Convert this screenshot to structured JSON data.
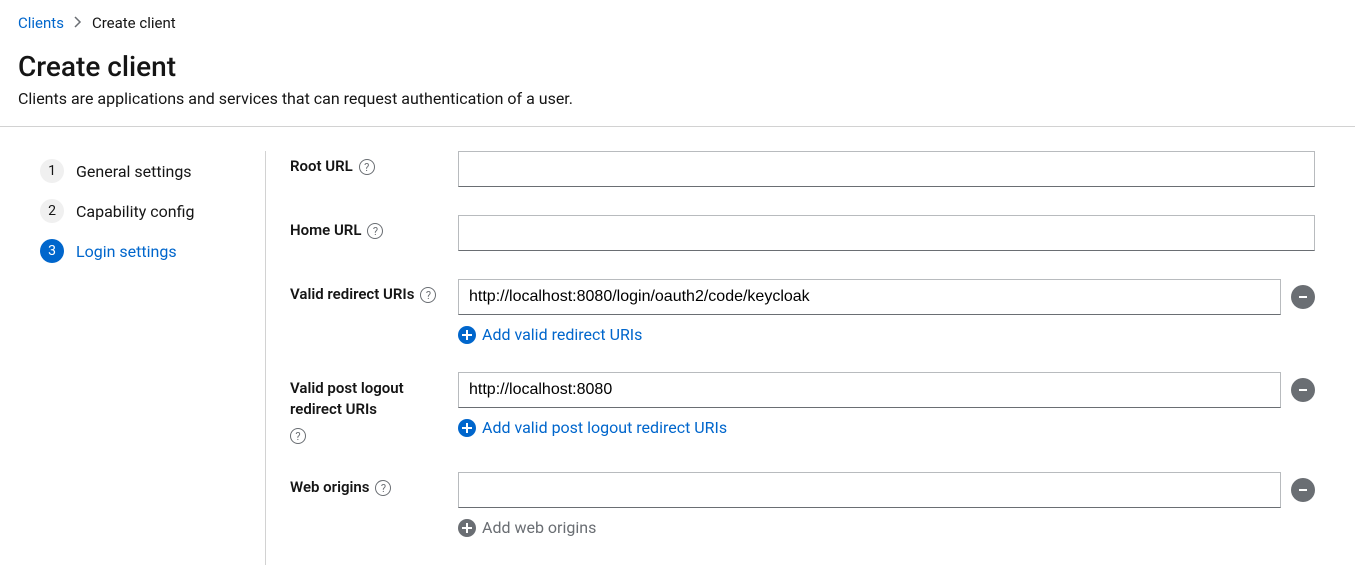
{
  "breadcrumb": {
    "parent": "Clients",
    "current": "Create client"
  },
  "page": {
    "title": "Create client",
    "description": "Clients are applications and services that can request authentication of a user."
  },
  "wizard": {
    "steps": [
      {
        "num": "1",
        "label": "General settings"
      },
      {
        "num": "2",
        "label": "Capability config"
      },
      {
        "num": "3",
        "label": "Login settings"
      }
    ]
  },
  "form": {
    "root_url": {
      "label": "Root URL",
      "value": ""
    },
    "home_url": {
      "label": "Home URL",
      "value": ""
    },
    "redirect_uris": {
      "label": "Valid redirect URIs",
      "value": "http://localhost:8080/login/oauth2/code/keycloak",
      "add_label": "Add valid redirect URIs"
    },
    "post_logout_uris": {
      "label": "Valid post logout redirect URIs",
      "value": "http://localhost:8080",
      "add_label": "Add valid post logout redirect URIs"
    },
    "web_origins": {
      "label": "Web origins",
      "value": "",
      "add_label": "Add web origins"
    }
  }
}
